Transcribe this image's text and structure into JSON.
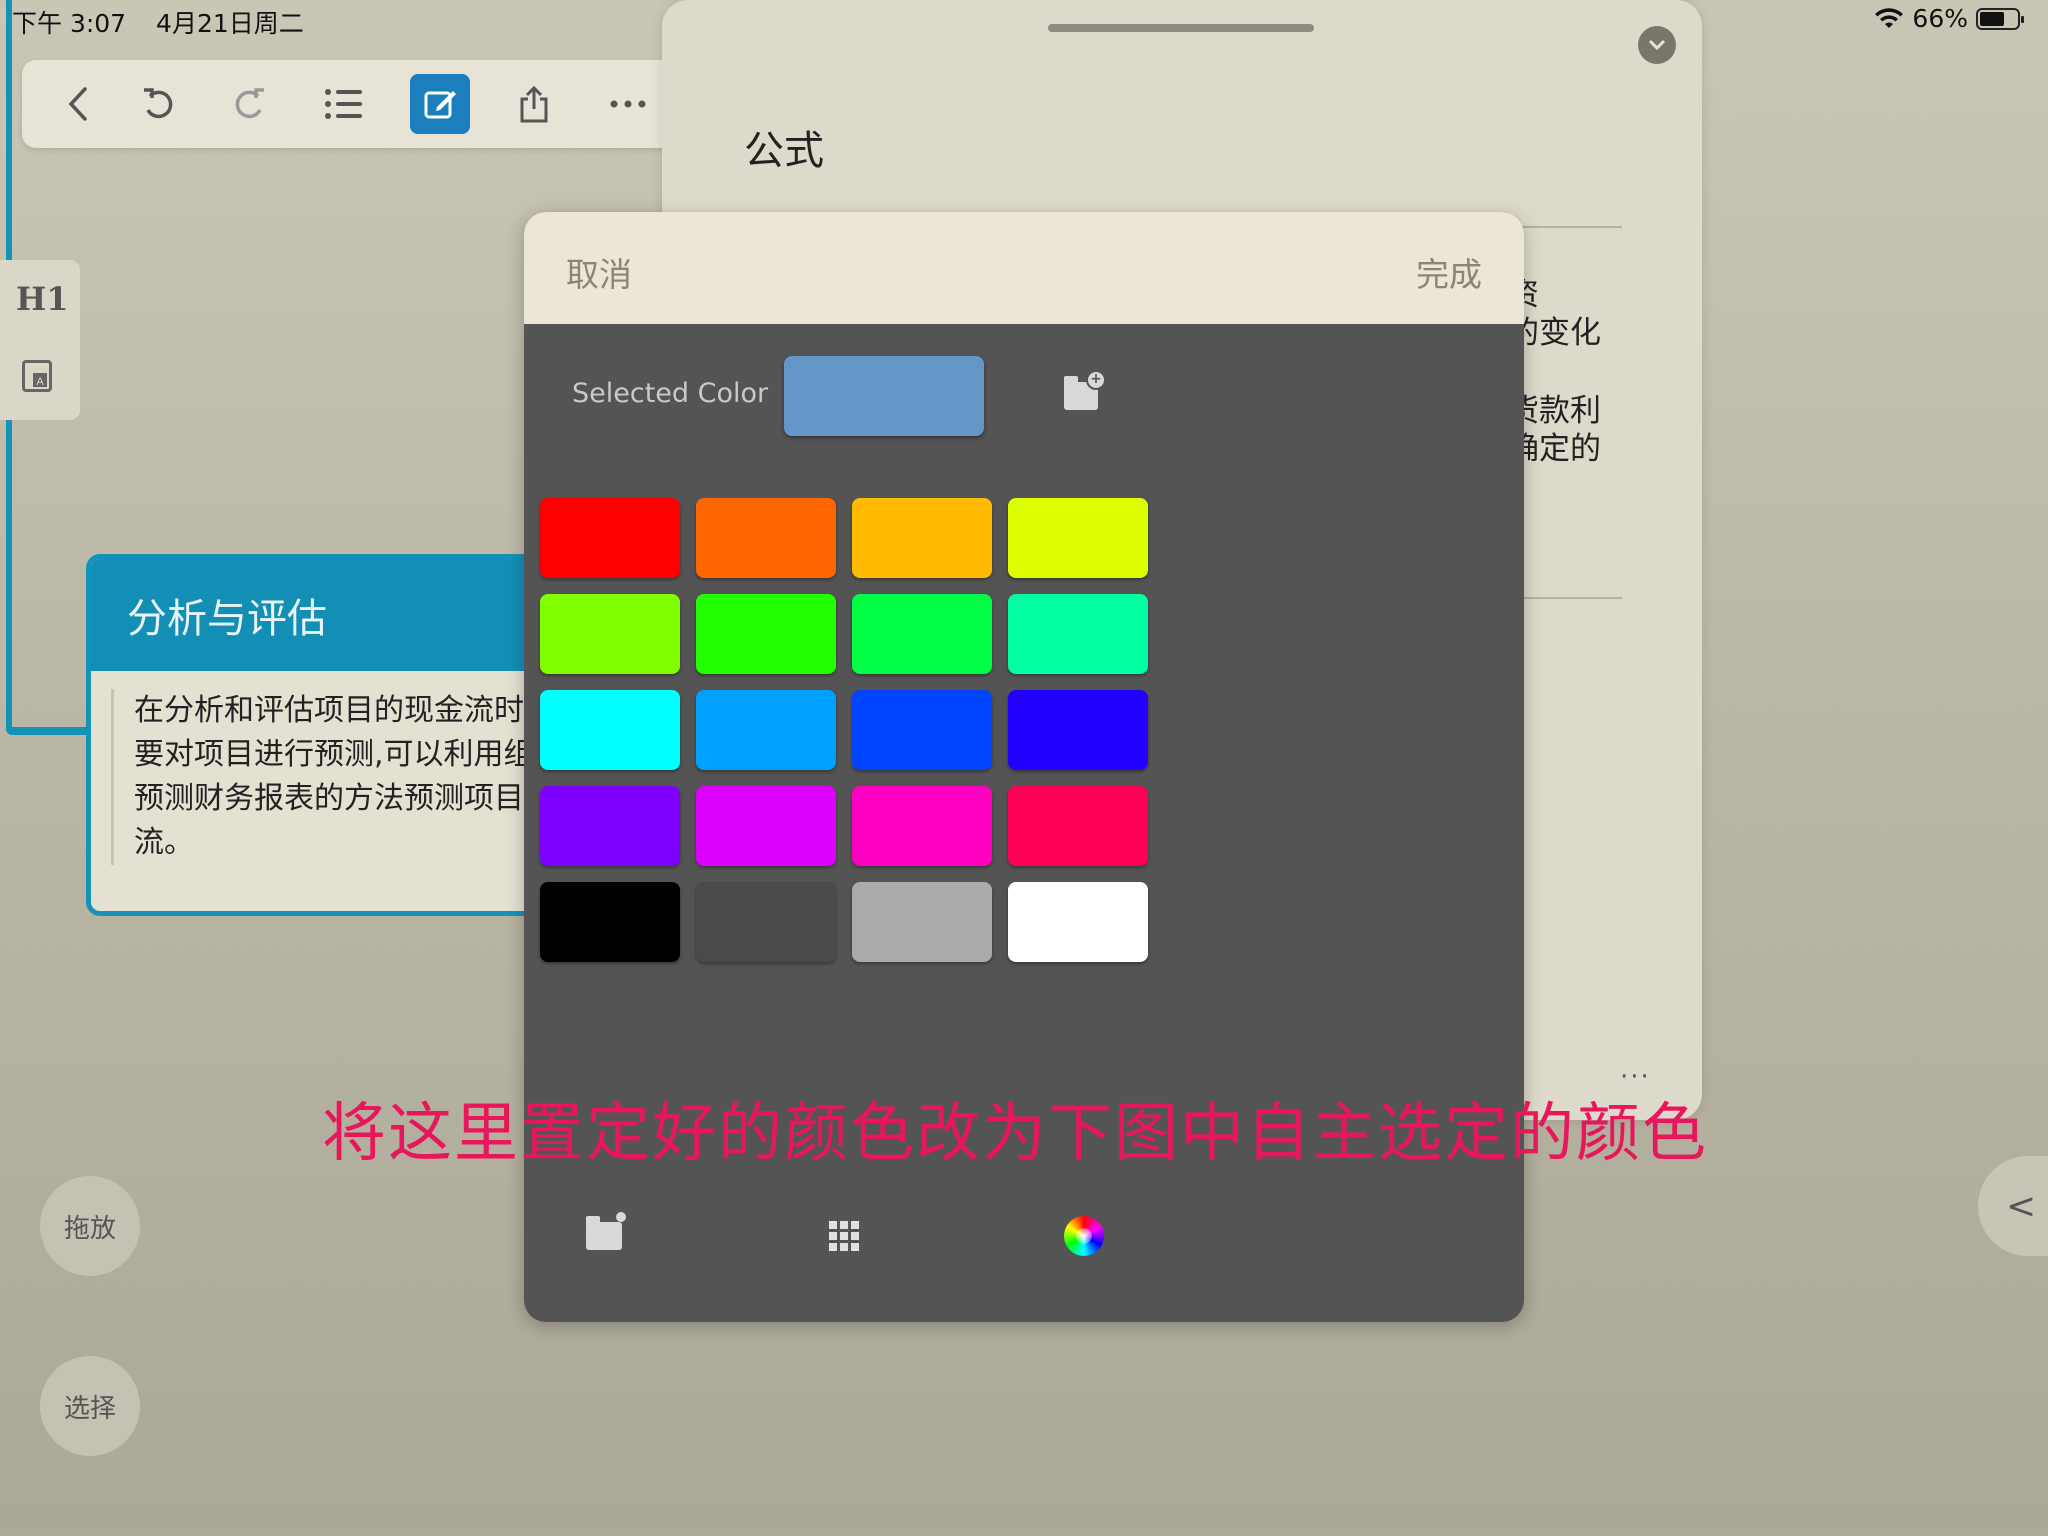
{
  "status_bar": {
    "time": "下午 3:07",
    "date": "4月21日周二",
    "battery": "66%",
    "battery_level": 0.66
  },
  "toolbar": {
    "icons": [
      "back-icon",
      "undo-icon",
      "redo-icon",
      "list-icon",
      "edit-icon",
      "share-icon",
      "more-icon"
    ],
    "active": "edit-icon"
  },
  "side_panel": {
    "heading_label": "H1"
  },
  "card": {
    "title": "分析与评估",
    "lines": [
      "在分析和评估项目的现金流时",
      "要对项目进行预测,可以利用组",
      "预测财务报表的方法预测项目",
      "流。"
    ]
  },
  "document": {
    "title": "公式",
    "text_fragments": [
      "资",
      "的变化",
      "货款利",
      "确定的"
    ],
    "more": "···"
  },
  "floating": {
    "drag_label": "拖放",
    "select_label": "选择",
    "expand_glyph": "<"
  },
  "color_picker": {
    "cancel_label": "取消",
    "done_label": "完成",
    "selected_label": "Selected Color",
    "selected_color": "#6596c8",
    "swatches": [
      [
        "#ff0000",
        "#ff6600",
        "#ffbb00",
        "#ddff00"
      ],
      [
        "#7fff00",
        "#22ff00",
        "#00ff44",
        "#00ffa0"
      ],
      [
        "#00ffff",
        "#00a0ff",
        "#0044ff",
        "#2200ff"
      ],
      [
        "#7f00ff",
        "#dd00ff",
        "#ff00c0",
        "#ff0055"
      ],
      [
        "#000000",
        "#4a4a4a",
        "#aaaaaa",
        "#ffffff"
      ]
    ],
    "tabs": [
      "saved-colors-icon",
      "grid-icon",
      "color-wheel-icon"
    ]
  },
  "annotation": {
    "text": "将这里置定好的颜色改为下图中自主选定的颜色",
    "color": "#e8175c"
  }
}
